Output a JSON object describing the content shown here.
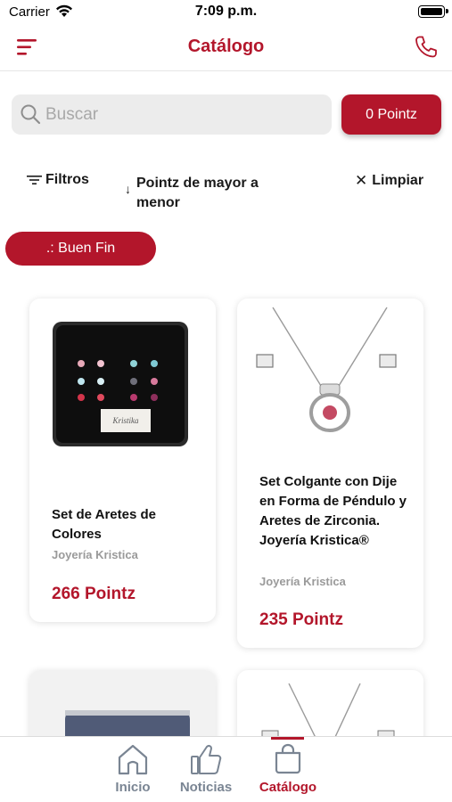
{
  "status_bar": {
    "carrier": "Carrier",
    "time": "7:09 p.m."
  },
  "nav": {
    "title": "Catálogo",
    "menu_icon": "hamburger-menu-icon",
    "phone_icon": "phone-icon"
  },
  "search": {
    "placeholder": "Buscar",
    "value": ""
  },
  "points_button": {
    "label": "0 Pointz"
  },
  "filters": {
    "filters_label": "Filtros",
    "sort_label": "Pointz de mayor a menor",
    "clear_label": "Limpiar"
  },
  "category_chip": {
    "label": ".: Buen Fin"
  },
  "products": [
    {
      "title": "Set de Aretes de Colores",
      "brand": "Joyería Kristica",
      "points": "266 Pointz",
      "box_label": "Kristika"
    },
    {
      "title": "Set Colgante con Dije en Forma de Péndulo y Aretes de Zirconia. Joyería Kristica®",
      "brand": "Joyería Kristica",
      "points": "235 Pointz"
    }
  ],
  "tab_bar": {
    "tabs": [
      {
        "label": "Inicio",
        "icon": "home-icon"
      },
      {
        "label": "Noticias",
        "icon": "thumbs-up-icon"
      },
      {
        "label": "Catálogo",
        "icon": "shopping-bag-icon"
      }
    ],
    "active_index": 2
  },
  "colors": {
    "accent": "#b3162b",
    "tab_inactive": "#7a8593",
    "search_bg": "#ececec"
  }
}
